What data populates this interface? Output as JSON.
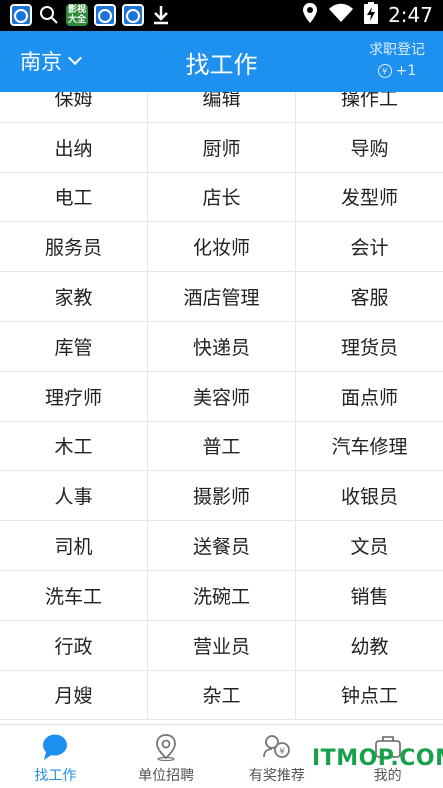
{
  "status_bar": {
    "time": "2:47",
    "app_green_label": "影视大全"
  },
  "header": {
    "city": "南京",
    "title": "找工作",
    "register_label": "求职登记",
    "register_bonus": "+1",
    "coin_symbol": "¥"
  },
  "jobs": [
    [
      "保姆",
      "编辑",
      "操作工"
    ],
    [
      "出纳",
      "厨师",
      "导购"
    ],
    [
      "电工",
      "店长",
      "发型师"
    ],
    [
      "服务员",
      "化妆师",
      "会计"
    ],
    [
      "家教",
      "酒店管理",
      "客服"
    ],
    [
      "库管",
      "快递员",
      "理货员"
    ],
    [
      "理疗师",
      "美容师",
      "面点师"
    ],
    [
      "木工",
      "普工",
      "汽车修理"
    ],
    [
      "人事",
      "摄影师",
      "收银员"
    ],
    [
      "司机",
      "送餐员",
      "文员"
    ],
    [
      "洗车工",
      "洗碗工",
      "销售"
    ],
    [
      "行政",
      "营业员",
      "幼教"
    ],
    [
      "月嫂",
      "杂工",
      "钟点工"
    ]
  ],
  "bottom_nav": [
    {
      "label": "找工作",
      "icon": "chat-bubble-icon",
      "active": true
    },
    {
      "label": "单位招聘",
      "icon": "location-pin-icon",
      "active": false
    },
    {
      "label": "有奖推荐",
      "icon": "reward-icon",
      "active": false
    },
    {
      "label": "我的",
      "icon": "profile-icon",
      "active": false
    }
  ],
  "watermark": "ITMOP.COM",
  "colors": {
    "primary": "#1e90f0",
    "watermark": "#19a04a"
  }
}
